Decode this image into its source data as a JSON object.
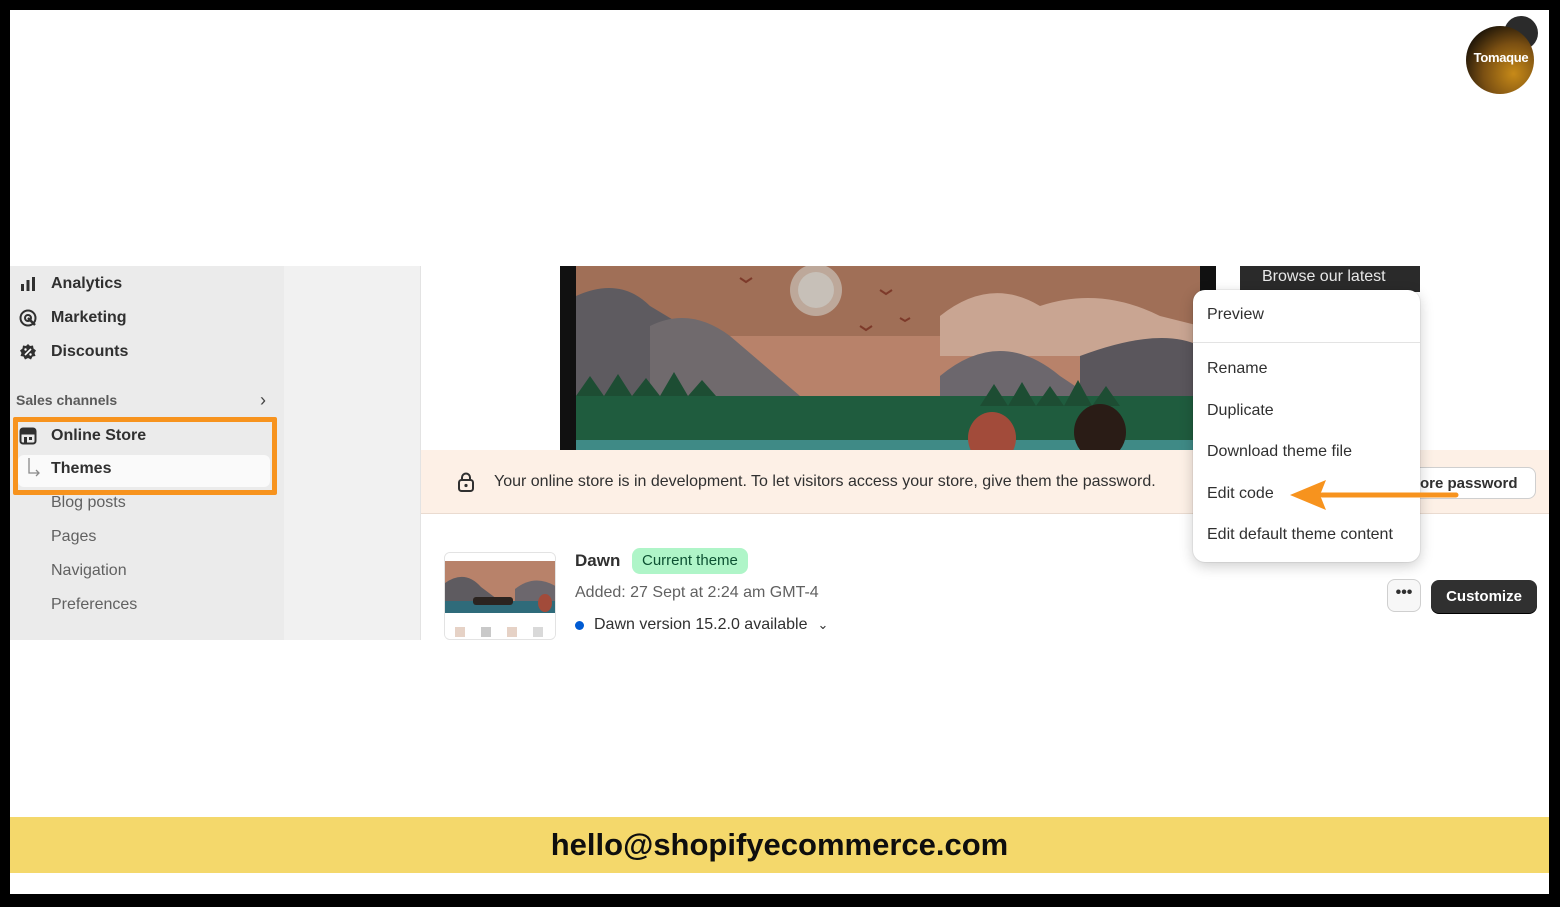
{
  "logo": {
    "text": "Tomaque"
  },
  "sidebar": {
    "items": [
      {
        "label": "Analytics",
        "icon": "analytics-icon"
      },
      {
        "label": "Marketing",
        "icon": "marketing-icon"
      },
      {
        "label": "Discounts",
        "icon": "discounts-icon"
      }
    ],
    "sales_channels": "Sales channels",
    "online_store": "Online Store",
    "sub_items": [
      "Themes",
      "Blog posts",
      "Pages",
      "Navigation",
      "Preferences"
    ]
  },
  "preview": {
    "side_text": "Browse our latest"
  },
  "dev_bar": {
    "message": "Your online store is in development. To let visitors access your store, give them the password.",
    "button": "tore password"
  },
  "theme": {
    "name": "Dawn",
    "badge": "Current theme",
    "added": "Added: 27 Sept at 2:24 am GMT-4",
    "version": "Dawn version 15.2.0 available",
    "more_label": "•••",
    "customize": "Customize"
  },
  "menu": {
    "items": [
      "Preview",
      "Rename",
      "Duplicate",
      "Download theme file",
      "Edit code",
      "Edit default theme content"
    ]
  },
  "contact": {
    "email": "hello@shopifyecommerce.com"
  },
  "colors": {
    "highlight": "#f7931e",
    "arrow": "#f7931e",
    "email_bar": "#f4d86b",
    "badge_bg": "#aff5c8"
  }
}
